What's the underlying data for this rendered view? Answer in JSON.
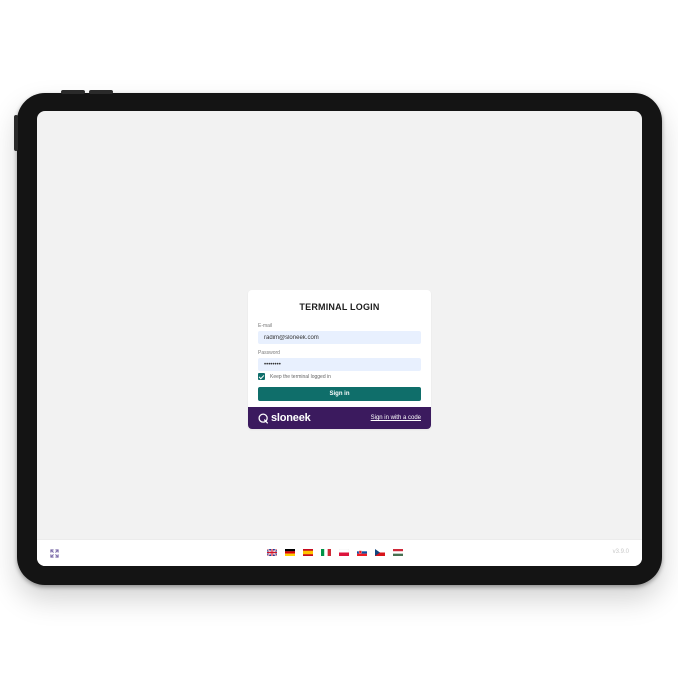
{
  "login": {
    "title": "TERMINAL LOGIN",
    "email_label": "E-mail",
    "email_value": "radim@sloneek.com",
    "password_label": "Password",
    "password_value": "••••••••",
    "keep_logged_in_label": "Keep the terminal logged in",
    "keep_logged_in_checked": true,
    "sign_in_label": "Sign in",
    "brand_name": "sloneek",
    "sign_in_code_label": "Sign in with a code"
  },
  "languages": [
    {
      "code": "en",
      "icon": "uk-flag-icon"
    },
    {
      "code": "de",
      "icon": "german-flag-icon"
    },
    {
      "code": "es",
      "icon": "spanish-flag-icon"
    },
    {
      "code": "it",
      "icon": "italian-flag-icon"
    },
    {
      "code": "pl",
      "icon": "polish-flag-icon"
    },
    {
      "code": "sk",
      "icon": "slovak-flag-icon"
    },
    {
      "code": "cz",
      "icon": "czech-flag-icon"
    },
    {
      "code": "hu",
      "icon": "hungarian-flag-icon"
    }
  ],
  "version": "v3.9.0",
  "colors": {
    "primary": "#0f6e6a",
    "brand_purple": "#3b1a5e",
    "screen_bg": "#f2f2f2",
    "input_bg": "#e8f0fe",
    "device_frame": "#141414"
  }
}
